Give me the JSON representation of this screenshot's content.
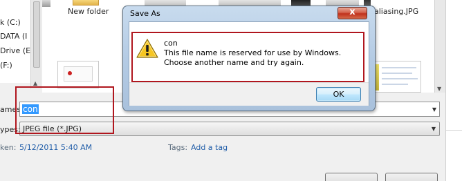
{
  "background_window": {
    "drives": [
      "k (C:)",
      "DATA (I",
      "Drive (E:",
      "(F:)"
    ],
    "files": {
      "new_folder_label": "New folder",
      "aliasing_label": "-aliasing.JPG"
    },
    "file_name": {
      "label": "ames:",
      "value": "con"
    },
    "save_as_type": {
      "label": "ypes:",
      "value": "JPEG file (*.JPG)"
    },
    "details": {
      "taken_label": "ken:",
      "taken_value": "5/12/2011 5:40 AM",
      "tags_label": "Tags:",
      "tags_value": "Add a tag"
    }
  },
  "dialog": {
    "title": "Save As",
    "close_label": "x",
    "message": {
      "filename": "con",
      "line1": "This file name is reserved for use by Windows.",
      "line2": "Choose another name and try again."
    },
    "ok_label": "OK"
  },
  "colors": {
    "highlight_red": "#b0161e",
    "selection_blue": "#3399ff",
    "link_blue": "#1f5ca8"
  },
  "icons": {
    "warning": "warning-icon",
    "close": "close-icon",
    "dropdown": "chevron-down-icon"
  }
}
